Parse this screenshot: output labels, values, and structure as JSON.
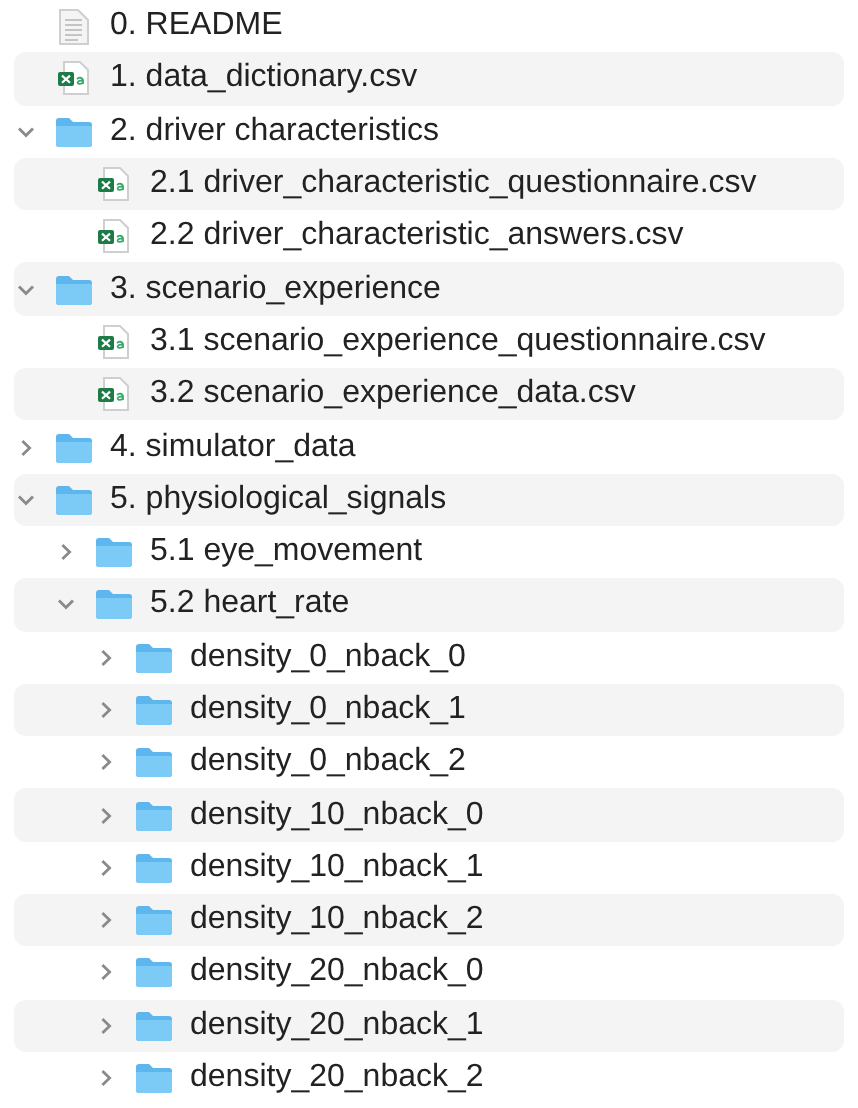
{
  "files": [
    {
      "kind": "document",
      "name": "0. README"
    },
    {
      "kind": "csv",
      "name": "1. data_dictionary.csv"
    },
    {
      "kind": "folder",
      "name": "2. driver characteristics",
      "expanded": true,
      "children": [
        {
          "kind": "csv",
          "name": "2.1 driver_characteristic_questionnaire.csv"
        },
        {
          "kind": "csv",
          "name": "2.2 driver_characteristic_answers.csv"
        }
      ]
    },
    {
      "kind": "folder",
      "name": "3. scenario_experience",
      "expanded": true,
      "children": [
        {
          "kind": "csv",
          "name": "3.1 scenario_experience_questionnaire.csv"
        },
        {
          "kind": "csv",
          "name": "3.2 scenario_experience_data.csv"
        }
      ]
    },
    {
      "kind": "folder",
      "name": "4. simulator_data",
      "expanded": false
    },
    {
      "kind": "folder",
      "name": "5. physiological_signals",
      "expanded": true,
      "children": [
        {
          "kind": "folder",
          "name": "5.1 eye_movement",
          "expanded": false
        },
        {
          "kind": "folder",
          "name": "5.2 heart_rate",
          "expanded": true,
          "children": [
            {
              "kind": "folder",
              "name": "density_0_nback_0",
              "expanded": false
            },
            {
              "kind": "folder",
              "name": "density_0_nback_1",
              "expanded": false
            },
            {
              "kind": "folder",
              "name": "density_0_nback_2",
              "expanded": false
            },
            {
              "kind": "folder",
              "name": "density_10_nback_0",
              "expanded": false
            },
            {
              "kind": "folder",
              "name": "density_10_nback_1",
              "expanded": false
            },
            {
              "kind": "folder",
              "name": "density_10_nback_2",
              "expanded": false
            },
            {
              "kind": "folder",
              "name": "density_20_nback_0",
              "expanded": false
            },
            {
              "kind": "folder",
              "name": "density_20_nback_1",
              "expanded": false
            },
            {
              "kind": "folder",
              "name": "density_20_nback_2",
              "expanded": false
            }
          ]
        }
      ]
    }
  ]
}
